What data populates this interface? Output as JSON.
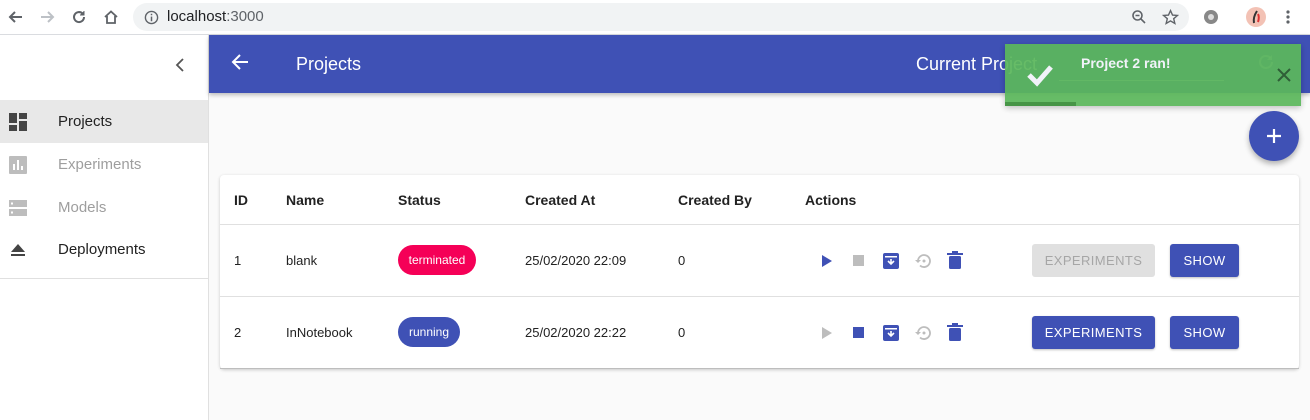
{
  "browser": {
    "url_host": "localhost",
    "url_port": ":3000"
  },
  "sidebar": {
    "items": [
      {
        "label": "Projects",
        "icon": "dashboard-icon",
        "active": true
      },
      {
        "label": "Experiments",
        "icon": "bar-chart-icon",
        "active": false
      },
      {
        "label": "Models",
        "icon": "storage-icon",
        "active": false
      },
      {
        "label": "Deployments",
        "icon": "eject-icon",
        "active": false
      }
    ]
  },
  "appbar": {
    "title": "Projects",
    "current_project_label": "Current Project"
  },
  "toast": {
    "message": "Project 2 ran!",
    "progress": 0.24
  },
  "table": {
    "headers": {
      "id": "ID",
      "name": "Name",
      "status": "Status",
      "created_at": "Created At",
      "created_by": "Created By",
      "actions": "Actions"
    },
    "rows": [
      {
        "id": "1",
        "name": "blank",
        "status": "terminated",
        "created_at": "25/02/2020 22:09",
        "created_by": "0",
        "experiments_label": "EXPERIMENTS",
        "show_label": "SHOW"
      },
      {
        "id": "2",
        "name": "InNotebook",
        "status": "running",
        "created_at": "25/02/2020 22:22",
        "created_by": "0",
        "experiments_label": "EXPERIMENTS",
        "show_label": "SHOW"
      }
    ]
  },
  "colors": {
    "primary": "#3f51b5",
    "terminated": "#f50057",
    "success": "#5cb85c"
  }
}
